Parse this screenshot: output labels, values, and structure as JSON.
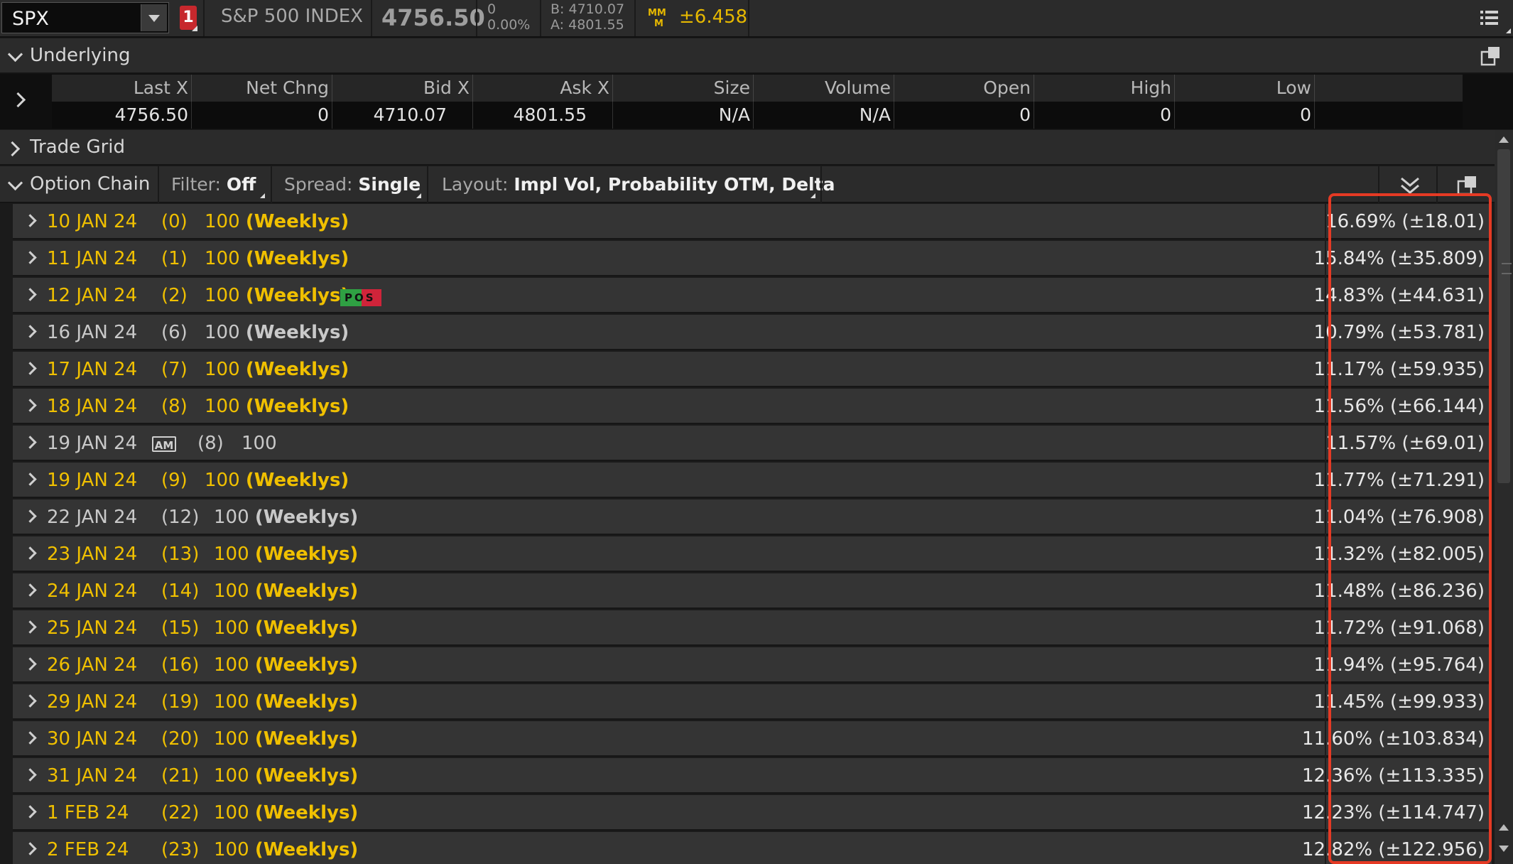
{
  "topbar": {
    "symbol": "SPX",
    "alert_count": "1",
    "index_name": "S&P 500 INDEX",
    "last_price": "4756.50",
    "net_change": "0",
    "percent_change": "0.00%",
    "bid_line": "B: 4710.07",
    "ask_line": "A: 4801.55",
    "mm_icon_text": "MM\nM",
    "market_maker_move": "±6.458"
  },
  "underlying": {
    "title": "Underlying",
    "columns": [
      "Last X",
      "Net Chng",
      "Bid X",
      "Ask X",
      "Size",
      "Volume",
      "Open",
      "High",
      "Low"
    ],
    "values": [
      "4756.50",
      "0",
      "4710.07",
      "4801.55",
      "N/A",
      "N/A",
      "0",
      "0",
      "0"
    ]
  },
  "trade_grid": {
    "title": "Trade Grid"
  },
  "option_chain": {
    "title": "Option Chain",
    "filter_label": "Filter:",
    "filter_value": "Off",
    "spread_label": "Spread:",
    "spread_value": "Single",
    "layout_label": "Layout:",
    "layout_value": "Impl Vol, Probability OTM, Delta",
    "rows": [
      {
        "date": "10 JAN 24",
        "days": "(0)",
        "mult": "100",
        "tag": "(Weeklys)",
        "iv": "16.69% (±18.01)",
        "highlight": true
      },
      {
        "date": "11 JAN 24",
        "days": "(1)",
        "mult": "100",
        "tag": "(Weeklys)",
        "iv": "15.84% (±35.809)",
        "highlight": true
      },
      {
        "date": "12 JAN 24",
        "days": "(2)",
        "mult": "100",
        "tag": "(Weeklys)",
        "iv": "14.83% (±44.631)",
        "highlight": true,
        "pos_badge": "POS"
      },
      {
        "date": "16 JAN 24",
        "days": "(6)",
        "mult": "100",
        "tag": "(Weeklys)",
        "iv": "10.79% (±53.781)",
        "highlight": false
      },
      {
        "date": "17 JAN 24",
        "days": "(7)",
        "mult": "100",
        "tag": "(Weeklys)",
        "iv": "11.17% (±59.935)",
        "highlight": true
      },
      {
        "date": "18 JAN 24",
        "days": "(8)",
        "mult": "100",
        "tag": "(Weeklys)",
        "iv": "11.56% (±66.144)",
        "highlight": true
      },
      {
        "date": "19 JAN 24",
        "days": "(8)",
        "mult": "100",
        "tag": "",
        "iv": "11.57% (±69.01)",
        "highlight": false,
        "am_badge": "AM"
      },
      {
        "date": "19 JAN 24",
        "days": "(9)",
        "mult": "100",
        "tag": "(Weeklys)",
        "iv": "11.77% (±71.291)",
        "highlight": true
      },
      {
        "date": "22 JAN 24",
        "days": "(12)",
        "mult": "100",
        "tag": "(Weeklys)",
        "iv": "11.04% (±76.908)",
        "highlight": false
      },
      {
        "date": "23 JAN 24",
        "days": "(13)",
        "mult": "100",
        "tag": "(Weeklys)",
        "iv": "11.32% (±82.005)",
        "highlight": true
      },
      {
        "date": "24 JAN 24",
        "days": "(14)",
        "mult": "100",
        "tag": "(Weeklys)",
        "iv": "11.48% (±86.236)",
        "highlight": true
      },
      {
        "date": "25 JAN 24",
        "days": "(15)",
        "mult": "100",
        "tag": "(Weeklys)",
        "iv": "11.72% (±91.068)",
        "highlight": true
      },
      {
        "date": "26 JAN 24",
        "days": "(16)",
        "mult": "100",
        "tag": "(Weeklys)",
        "iv": "11.94% (±95.764)",
        "highlight": true
      },
      {
        "date": "29 JAN 24",
        "days": "(19)",
        "mult": "100",
        "tag": "(Weeklys)",
        "iv": "11.45% (±99.933)",
        "highlight": true
      },
      {
        "date": "30 JAN 24",
        "days": "(20)",
        "mult": "100",
        "tag": "(Weeklys)",
        "iv": "11.60% (±103.834)",
        "highlight": true
      },
      {
        "date": "31 JAN 24",
        "days": "(21)",
        "mult": "100",
        "tag": "(Weeklys)",
        "iv": "12.36% (±113.335)",
        "highlight": true
      },
      {
        "date": "1 FEB 24",
        "days": "(22)",
        "mult": "100",
        "tag": "(Weeklys)",
        "iv": "12.23% (±114.747)",
        "highlight": true
      },
      {
        "date": "2 FEB 24",
        "days": "(23)",
        "mult": "100",
        "tag": "(Weeklys)",
        "iv": "12.82% (±122.956)",
        "highlight": true
      }
    ]
  },
  "colors": {
    "accent_yellow": "#f0c000",
    "highlight_red": "#e53a24",
    "row_bg": "#343434",
    "alert_red": "#c7282d"
  },
  "icons": {
    "menu": "list-menu-icon",
    "popout": "popout-window-icon",
    "collapse": "chevron-down-icon",
    "expand": "chevron-right-icon",
    "expand_all": "double-chevron-down-icon"
  }
}
